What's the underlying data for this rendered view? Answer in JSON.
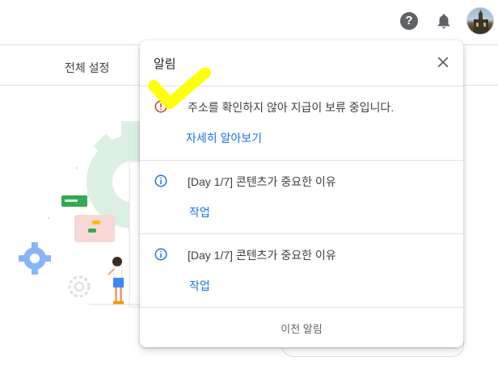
{
  "header": {
    "help_icon": "help-circle-icon",
    "help_glyph": "?",
    "notifications_icon": "bell-icon",
    "avatar_icon": "user-avatar"
  },
  "settings_tab": {
    "label": "전체 설정"
  },
  "notifications": {
    "title": "알림",
    "close_icon": "close-icon",
    "items": [
      {
        "icon": "error-circle-icon",
        "color": "#d93025",
        "text": "주소를 확인하지 않아 지급이 보류 중입니다.",
        "link": "자세히 알아보기"
      },
      {
        "icon": "info-circle-icon",
        "color": "#1a73e8",
        "text": "[Day 1/7] 콘텐츠가 중요한 이유",
        "link": "작업"
      },
      {
        "icon": "info-circle-icon",
        "color": "#1a73e8",
        "text": "[Day 1/7] 콘텐츠가 중요한 이유",
        "link": "작업"
      }
    ],
    "footer_link": "이전 알림"
  },
  "colors": {
    "accent": "#1a73e8",
    "error": "#d93025",
    "highlight": "#ffff00"
  }
}
